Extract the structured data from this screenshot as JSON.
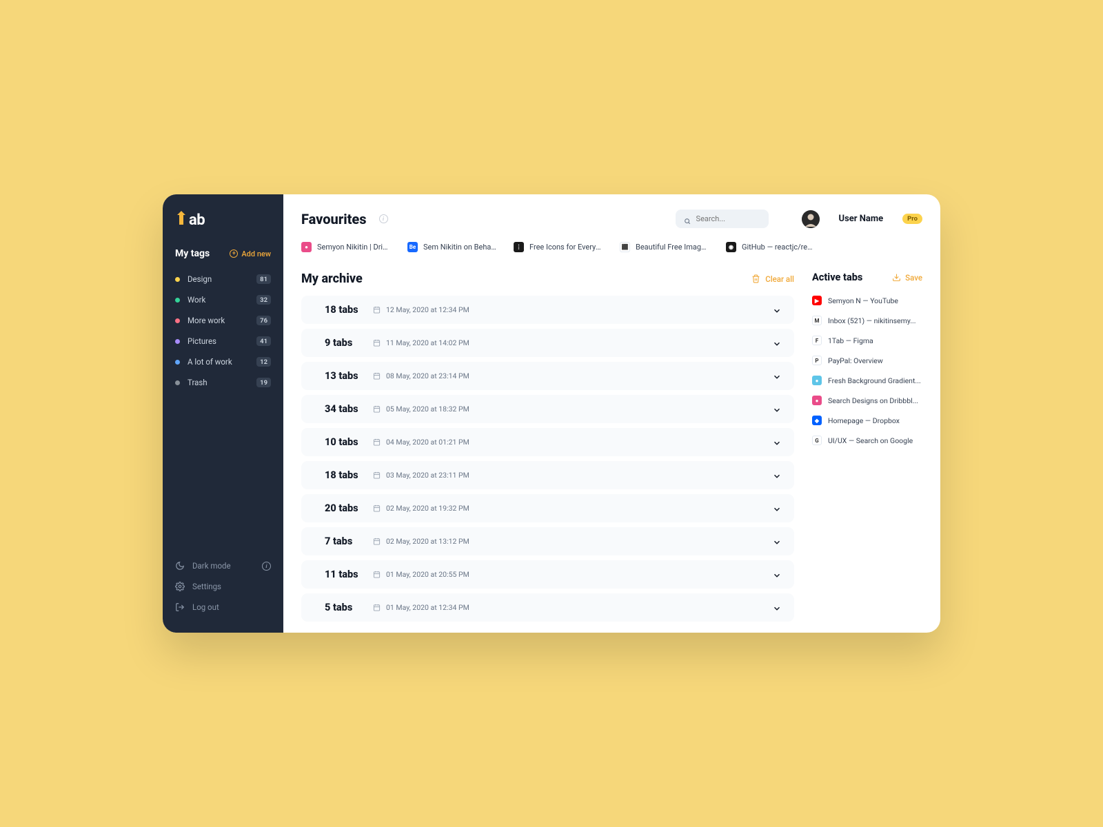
{
  "logo_text": "ab",
  "sidebar": {
    "title": "My tags",
    "add_new": "Add new",
    "tags": [
      {
        "label": "Design",
        "count": "81",
        "color": "#fcd34d"
      },
      {
        "label": "Work",
        "count": "32",
        "color": "#34d399"
      },
      {
        "label": "More work",
        "count": "76",
        "color": "#fb7185"
      },
      {
        "label": "Pictures",
        "count": "41",
        "color": "#a78bfa"
      },
      {
        "label": "A lot of work",
        "count": "12",
        "color": "#60a5fa"
      },
      {
        "label": "Trash",
        "count": "19",
        "color": "#889099"
      }
    ],
    "dark_mode": "Dark mode",
    "settings": "Settings",
    "logout": "Log out"
  },
  "header": {
    "favourites": "Favourites",
    "search_placeholder": "Search...",
    "username": "User Name",
    "pro": "Pro"
  },
  "favourites": [
    {
      "label": "Semyon Nikitin | Dribb...",
      "bg": "#ea4c89",
      "letter": "●"
    },
    {
      "label": "Sem Nikitin on Behan...",
      "bg": "#1769ff",
      "letter": "Be"
    },
    {
      "label": "Free Icons for Everyth...",
      "bg": "#1a1a1a",
      "letter": "⋮⋮⋮"
    },
    {
      "label": "Beautiful Free Images...",
      "bg": "#ffffff",
      "letter": "⬛"
    },
    {
      "label": "GitHub — reactjc/reac...",
      "bg": "#1a1a1a",
      "letter": "◉"
    }
  ],
  "archive": {
    "title": "My archive",
    "clear": "Clear all",
    "items": [
      {
        "count": "18 tabs",
        "date": "12 May, 2020 at 12:34 PM"
      },
      {
        "count": "9 tabs",
        "date": "11 May, 2020 at 14:02 PM"
      },
      {
        "count": "13 tabs",
        "date": "08 May, 2020 at 23:14 PM"
      },
      {
        "count": "34 tabs",
        "date": "05 May, 2020 at 18:32 PM"
      },
      {
        "count": "10 tabs",
        "date": "04 May, 2020 at 01:21 PM"
      },
      {
        "count": "18 tabs",
        "date": "03 May, 2020 at 23:11 PM"
      },
      {
        "count": "20 tabs",
        "date": "02 May, 2020 at 19:32 PM"
      },
      {
        "count": "7 tabs",
        "date": "02 May, 2020 at 13:12 PM"
      },
      {
        "count": "11 tabs",
        "date": "01 May, 2020 at 20:55 PM"
      },
      {
        "count": "5 tabs",
        "date": "01 May, 2020 at 12:34 PM"
      }
    ]
  },
  "active": {
    "title": "Active tabs",
    "save": "Save",
    "items": [
      {
        "label": "Semyon N —  YouTube",
        "bg": "#ff0000",
        "letter": "▶"
      },
      {
        "label": "Inbox (521) —  nikitinsemy...",
        "bg": "#ffffff",
        "letter": "M"
      },
      {
        "label": "1Tab —  Figma",
        "bg": "#ffffff",
        "letter": "F"
      },
      {
        "label": "PayPal: Overview",
        "bg": "#ffffff",
        "letter": "P"
      },
      {
        "label": "Fresh Background Gradient...",
        "bg": "#5ec5e8",
        "letter": "●"
      },
      {
        "label": "Search Designs on Dribbbl...",
        "bg": "#ea4c89",
        "letter": "●"
      },
      {
        "label": "Homepage —  Dropbox",
        "bg": "#0061ff",
        "letter": "◆"
      },
      {
        "label": "UI/UX — Search on Google",
        "bg": "#ffffff",
        "letter": "G"
      }
    ]
  }
}
